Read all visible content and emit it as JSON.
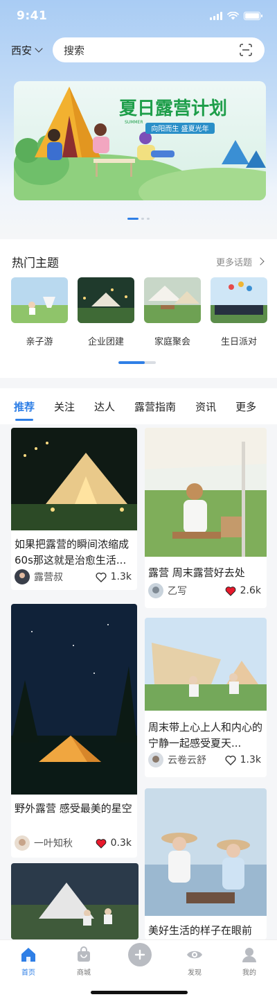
{
  "status": {
    "time": "9:41"
  },
  "header": {
    "city": "西安",
    "search_placeholder": "搜索"
  },
  "banner": {
    "title": "夏日露营计划",
    "subtitle": "向阳而生 盛夏光年",
    "small_text": "SUMMER",
    "page_count": 3,
    "active_page": 1
  },
  "hot_topics": {
    "title": "热门主题",
    "more_label": "更多话题",
    "items": [
      {
        "label": "亲子游"
      },
      {
        "label": "企业团建"
      },
      {
        "label": "家庭聚会"
      },
      {
        "label": "生日派对"
      }
    ],
    "scroll_progress": 0.7
  },
  "tabs": {
    "items": [
      "推荐",
      "关注",
      "达人",
      "露营指南",
      "资讯",
      "更多"
    ],
    "active_index": 0
  },
  "feed": [
    {
      "title": "如果把露营的瞬间浓缩成60s那这就是治愈生活...",
      "author": "露营叔",
      "likes": "1.3k",
      "liked": false
    },
    {
      "title": "露营 周末露营好去处",
      "author": "乙写",
      "likes": "2.6k",
      "liked": true
    },
    {
      "title": "野外露营 感受最美的星空",
      "author": "一叶知秋",
      "likes": "0.3k",
      "liked": true
    },
    {
      "title": "周末带上心上人和内心的宁静一起感受夏天...",
      "author": "云卷云舒",
      "likes": "1.3k",
      "liked": false
    },
    {
      "title": "",
      "author": "",
      "likes": "",
      "liked": false
    },
    {
      "title": "美好生活的样子在眼前",
      "author": "",
      "likes": "",
      "liked": false
    }
  ],
  "tabbar": {
    "items": [
      {
        "label": "首页",
        "icon": "home-icon",
        "active": true
      },
      {
        "label": "商城",
        "icon": "shopping-bag-icon",
        "active": false
      },
      {
        "label": "",
        "icon": "plus-icon",
        "active": false
      },
      {
        "label": "发现",
        "icon": "eye-icon",
        "active": false
      },
      {
        "label": "我的",
        "icon": "user-icon",
        "active": false
      }
    ]
  },
  "colors": {
    "accent": "#2f7fe6",
    "heart": "#e8192c"
  }
}
